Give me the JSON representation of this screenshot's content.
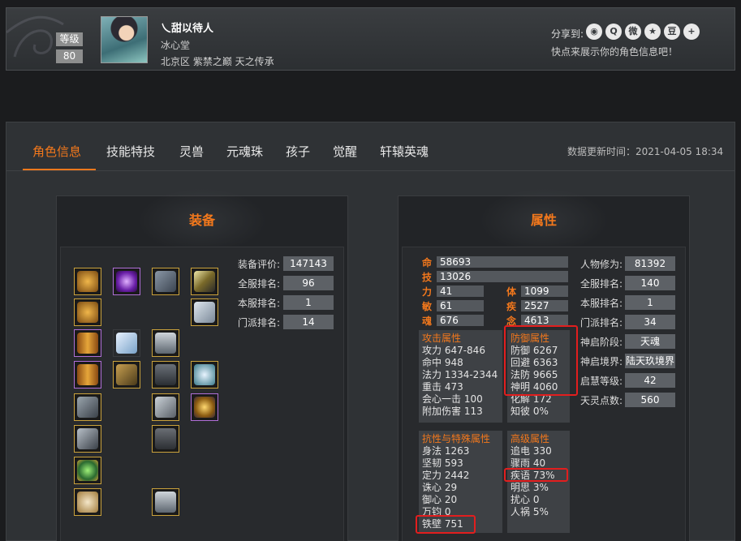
{
  "header": {
    "level_label": "等级",
    "level_value": "80",
    "char_name": "乀甜以待人",
    "sect": "冰心堂",
    "server": "北京区 紫禁之巅 天之传承",
    "share_label": "分享到:",
    "share_icons": [
      "wechat-icon",
      "qq-icon",
      "weibo-icon",
      "qzone-icon",
      "douban-icon",
      "more-icon"
    ],
    "share_glyphs": [
      "◉",
      "Q",
      "微",
      "★",
      "豆",
      "+"
    ],
    "share_tip": "快点来展示你的角色信息吧！"
  },
  "tabs": [
    {
      "label": "角色信息",
      "active": true
    },
    {
      "label": "技能特技",
      "active": false
    },
    {
      "label": "灵兽",
      "active": false
    },
    {
      "label": "元魂珠",
      "active": false
    },
    {
      "label": "孩子",
      "active": false
    },
    {
      "label": "觉醒",
      "active": false
    },
    {
      "label": "轩辕英魂",
      "active": false
    }
  ],
  "update_time": "数据更新时间：2021-04-05 18:34",
  "equipment": {
    "title": "装备",
    "stats": [
      {
        "label": "装备评价:",
        "value": "147143"
      },
      {
        "label": "全服排名:",
        "value": "96"
      },
      {
        "label": "本服排名:",
        "value": "1"
      },
      {
        "label": "门派排名:",
        "value": "14"
      }
    ]
  },
  "attributes": {
    "title": "属性",
    "base": [
      {
        "key": "命",
        "value": "58693"
      },
      {
        "key": "技",
        "value": "13026"
      }
    ],
    "base_pairs": [
      {
        "k1": "力",
        "v1": "41",
        "k2": "体",
        "v2": "1099"
      },
      {
        "k1": "敏",
        "v1": "61",
        "k2": "疾",
        "v2": "2527"
      },
      {
        "k1": "魂",
        "v1": "676",
        "k2": "念",
        "v2": "4613"
      }
    ],
    "attack": {
      "header": "攻击属性",
      "lines": [
        "攻力 647-846",
        "命中 948",
        "法力 1334-2344",
        "重击 473",
        "会心一击 100",
        "附加伤害 113"
      ]
    },
    "defense": {
      "header": "防御属性",
      "lines": [
        "防御 6267",
        "回避 6363",
        "法防 9665",
        "神明 4060",
        "化解 172",
        "知彼 0%"
      ]
    },
    "resist": {
      "header": "抗性与特殊属性",
      "lines": [
        "身法 1263",
        "坚韧 593",
        "定力 2442",
        "诛心 29",
        "御心 20",
        "万钧 0",
        "铁壁 751"
      ]
    },
    "advanced": {
      "header": "高级属性",
      "lines": [
        "追电 330",
        "骤雨 40",
        "疾语 73%",
        "明思 3%",
        "扰心 0",
        "人祸 5%"
      ]
    },
    "right": [
      {
        "label": "人物修为:",
        "value": "81392"
      },
      {
        "label": "全服排名:",
        "value": "140"
      },
      {
        "label": "本服排名:",
        "value": "1"
      },
      {
        "label": "门派排名:",
        "value": "34"
      },
      {
        "label": "神启阶段:",
        "value": "天魂"
      },
      {
        "label": "神启境界:",
        "value": "陆天玖境界"
      },
      {
        "label": "启慧等级:",
        "value": "42"
      },
      {
        "label": "天灵点数:",
        "value": "560"
      }
    ]
  },
  "colors": {
    "accent": "#f3781c",
    "highlight_box": "#e21e1e"
  }
}
